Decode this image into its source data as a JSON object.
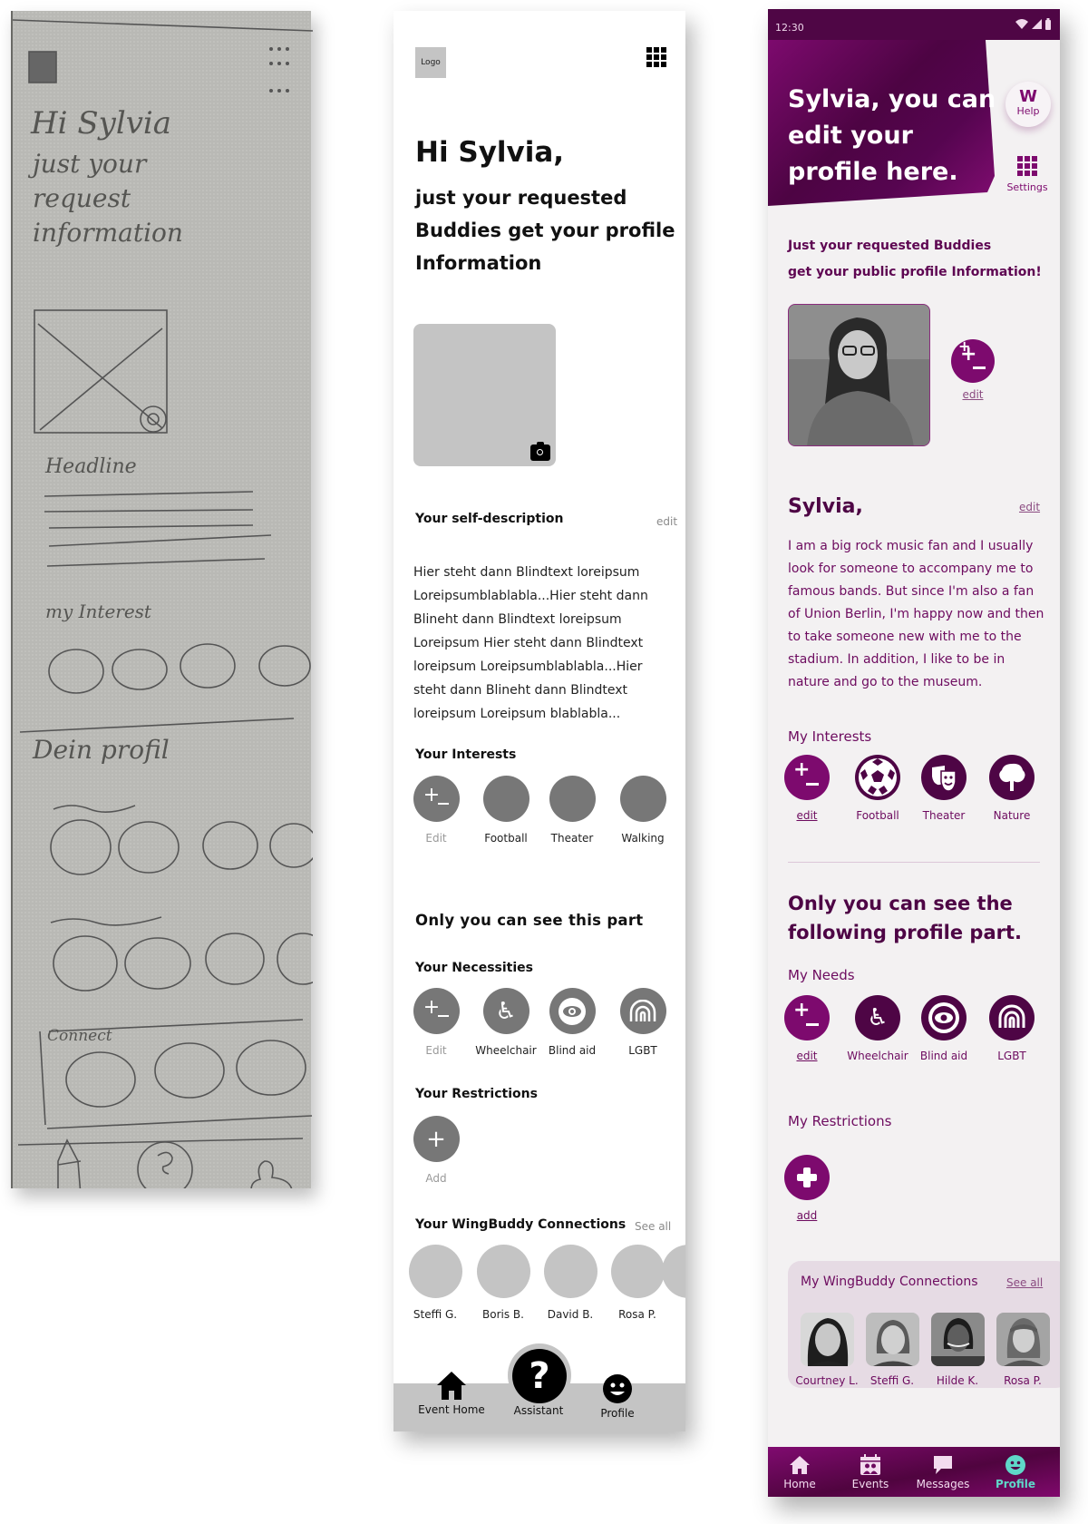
{
  "sketch": {
    "greeting": "Hi Sylvia",
    "greeting_sub_lines": [
      "just your",
      "request",
      "information"
    ],
    "headline": "Headline",
    "interests_label": "my Interest",
    "profile_label": "Dein profil",
    "connect_label": "Connect"
  },
  "wireframe": {
    "logo": "Logo",
    "greeting": "Hi Sylvia,",
    "subtitle": "just your requested Buddies get your profile Information",
    "self_description_title": "Your self-description",
    "self_description_edit": "edit",
    "self_description_text": "Hier steht dann Blindtext loreipsum Loreipsumblablabla...Hier steht dann Blineht dann Blindtext loreipsum Loreipsum Hier steht dann Blindtext loreipsum Loreipsumblablabla...Hier steht dann Blineht dann Blindtext loreipsum Loreipsum blablabla...",
    "interests_title": "Your Interests",
    "interests": [
      {
        "label": "Edit",
        "icon": "plus-minus-icon"
      },
      {
        "label": "Football",
        "icon": "placeholder-icon"
      },
      {
        "label": "Theater",
        "icon": "placeholder-icon"
      },
      {
        "label": "Walking",
        "icon": "placeholder-icon"
      }
    ],
    "private_heading": "Only you can see this part",
    "necessities_title": "Your Necessities",
    "necessities": [
      {
        "label": "Edit",
        "icon": "plus-minus-icon"
      },
      {
        "label": "Wheelchair",
        "icon": "wheelchair-icon"
      },
      {
        "label": "Blind aid",
        "icon": "eye-icon"
      },
      {
        "label": "LGBT",
        "icon": "rainbow-icon"
      }
    ],
    "restrictions_title": "Your Restrictions",
    "restrictions_add": "Add",
    "connections_title": "Your WingBuddy Connections",
    "connections_see_all": "See all",
    "connections": [
      "Steffi G.",
      "Boris B.",
      "David B.",
      "Rosa P."
    ],
    "nav": [
      {
        "label": "Event Home",
        "icon": "home-icon"
      },
      {
        "label": "Assistant",
        "icon": "question-icon"
      },
      {
        "label": "Profile",
        "icon": "smiley-icon"
      }
    ]
  },
  "hifi": {
    "status_time": "12:30",
    "header_title": "Sylvia, you can edit your profile here.",
    "help_label": "Help",
    "settings_label": "Settings",
    "intro_line1": "Just your requested Buddies",
    "intro_line2": "get your public profile Information!",
    "photo_edit": "edit",
    "name": "Sylvia,",
    "name_edit": "edit",
    "bio": "I am a big rock music fan and I usually look for someone to accompany me to famous bands. But since I'm also a fan of Union Berlin, I'm happy now and then to take someone new with me to the stadium. In addition, I like to be in nature and go to the museum.",
    "interests_title": "My Interests",
    "interests": [
      {
        "label": "edit",
        "icon": "plus-minus-icon"
      },
      {
        "label": "Football",
        "icon": "football-icon"
      },
      {
        "label": "Theater",
        "icon": "theater-masks-icon"
      },
      {
        "label": "Nature",
        "icon": "tree-icon"
      }
    ],
    "private_heading": "Only you can see the following profile part.",
    "needs_title": "My Needs",
    "needs": [
      {
        "label": "edit",
        "icon": "plus-minus-icon"
      },
      {
        "label": "Wheelchair",
        "icon": "wheelchair-icon"
      },
      {
        "label": "Blind aid",
        "icon": "eye-icon"
      },
      {
        "label": "LGBT",
        "icon": "rainbow-icon"
      }
    ],
    "restrictions_title": "My Restrictions",
    "restrictions_add": "add",
    "connections_title": "My WingBuddy Connections",
    "connections_see_all": "See all",
    "connections": [
      "Courtney L.",
      "Steffi G.",
      "Hilde K.",
      "Rosa P."
    ],
    "tabs": [
      {
        "label": "Home",
        "icon": "home-icon",
        "active": false
      },
      {
        "label": "Events",
        "icon": "calendar-people-icon",
        "active": false
      },
      {
        "label": "Messages",
        "icon": "chat-bubble-icon",
        "active": false
      },
      {
        "label": "Profile",
        "icon": "smiley-icon",
        "active": true
      }
    ],
    "colors": {
      "primary": "#7d0a6e",
      "dark": "#4e0545",
      "background": "#f3f1f2",
      "active_tab": "#5fd8c9",
      "card": "#e6dbe4"
    }
  }
}
